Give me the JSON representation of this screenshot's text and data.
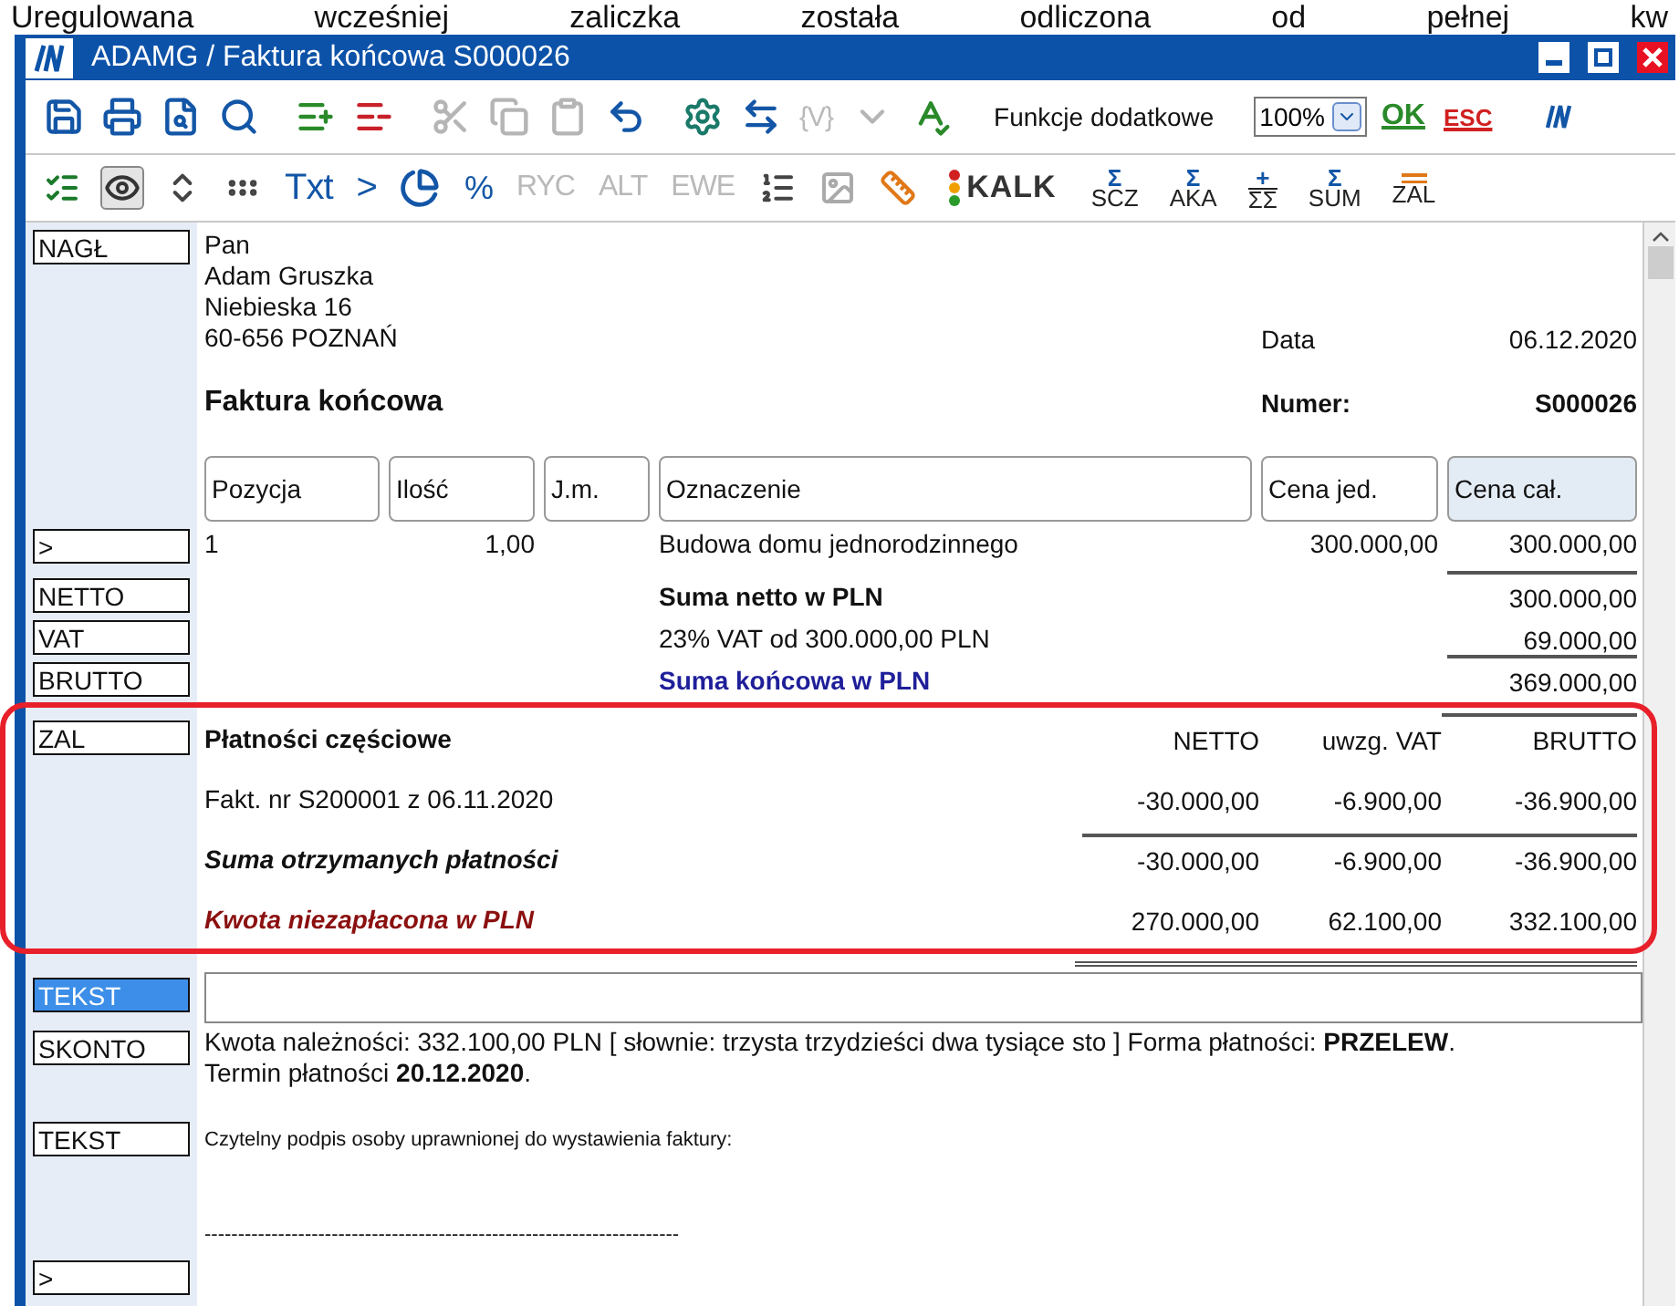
{
  "caption": "Uregulowana wcześniej zaliczka została odliczona od pełnej kw",
  "window": {
    "title": "ADAMG / Faktura końcowa S000026"
  },
  "toolbar_1": {
    "variables": {
      "label": "{V}",
      "disabled": true
    },
    "menu_label": "Funkcje dodatkowe",
    "zoom": "100%",
    "ok": "OK",
    "esc": "ESC"
  },
  "toolbar_2": {
    "view_pressed": true,
    "texts": [
      {
        "label": "Txt",
        "disabled": false
      },
      {
        "label": ">",
        "disabled": false
      },
      {
        "label": "%",
        "disabled": false
      },
      {
        "label": "RYC",
        "disabled": true
      },
      {
        "label": "ALT",
        "disabled": true
      },
      {
        "label": "EWE",
        "disabled": true
      }
    ],
    "kalk": "KALK",
    "sums": [
      {
        "top": "Σ",
        "label": "SCZ"
      },
      {
        "top": "Σ",
        "label": "AKA"
      },
      {
        "top": "+",
        "label": "ΣΣ"
      },
      {
        "top": "Σ",
        "label": "SUM"
      }
    ],
    "zal": "ZAL"
  },
  "document": {
    "header": {
      "tag": "NAGŁ",
      "tag_selected": false,
      "address": [
        "Pan",
        "Adam Gruszka",
        "Niebieska 16",
        "60-656 POZNAŃ"
      ],
      "date_label": "Data",
      "date": "06.12.2020",
      "title": "Faktura końcowa",
      "number_label": "Numer:",
      "number": "S000026",
      "columns": [
        {
          "label": "Pozycja",
          "selected": false
        },
        {
          "label": "Ilość",
          "selected": false
        },
        {
          "label": "J.m.",
          "selected": false
        },
        {
          "label": "Oznaczenie",
          "selected": false
        },
        {
          "label": "Cena jed.",
          "selected": false
        },
        {
          "label": "Cena cał.",
          "selected": true
        }
      ]
    },
    "item": {
      "tag": ">",
      "tag_selected": false,
      "cells": [
        "1",
        "1,00",
        "",
        "Budowa domu jednorodzinnego",
        "300.000,00",
        "300.000,00"
      ]
    },
    "totals": [
      {
        "tag": "NETTO",
        "tag_selected": false,
        "kind": "bold",
        "label": "Suma netto w PLN",
        "value": "300.000,00",
        "rule_above": true
      },
      {
        "tag": "VAT",
        "tag_selected": false,
        "kind": "plain",
        "label": "23% VAT od 300.000,00 PLN",
        "value": "69.000,00",
        "rule_above": false
      },
      {
        "tag": "BRUTTO",
        "tag_selected": false,
        "kind": "final",
        "label": "Suma końcowa w PLN",
        "value": "369.000,00",
        "rule_above": true
      }
    ],
    "payments": {
      "tag": "ZAL",
      "tag_selected": false,
      "highlighted": true,
      "title": "Płatności częściowe",
      "headers": [
        "NETTO",
        "uwzg. VAT",
        "BRUTTO"
      ],
      "rows": [
        {
          "kind": "entry",
          "label": "Fakt. nr S200001 z 06.11.2020",
          "values": [
            "-30.000,00",
            "-6.900,00",
            "-36.900,00"
          ]
        },
        {
          "kind": "sum",
          "label": "Suma otrzymanych płatności",
          "values": [
            "-30.000,00",
            "-6.900,00",
            "-36.900,00"
          ]
        },
        {
          "kind": "due",
          "label": "Kwota niezapłacona w PLN",
          "values": [
            "270.000,00",
            "62.100,00",
            "332.100,00"
          ]
        }
      ]
    },
    "text_block": {
      "tag": "TEKST",
      "tag_selected": true
    },
    "discount": {
      "tag": "SKONTO",
      "tag_selected": false,
      "lines": [
        "Kwota należności: 332.100,00 PLN [ słownie: trzysta trzydzieści dwa tysiące sto  ] Forma płatności: **PRZELEW**.",
        "Termin płatności **20.12.2020**."
      ]
    },
    "signature": {
      "tag": "TEKST",
      "tag_selected": false,
      "label": "Czytelny podpis osoby uprawnionej do wystawienia faktury:",
      "line": "-----------------------------------------------------------------------"
    },
    "end": {
      "tag": ">",
      "tag_selected": false
    }
  }
}
